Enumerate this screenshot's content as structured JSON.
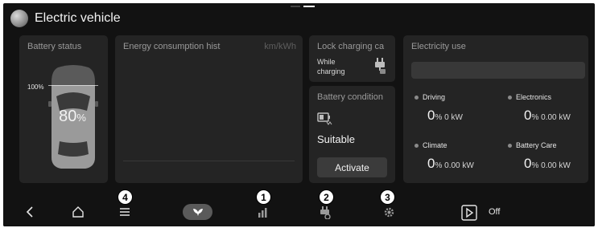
{
  "header": {
    "title": "Electric vehicle"
  },
  "battery": {
    "title": "Battery status",
    "full_label": "100%",
    "level_value": "80",
    "level_unit": "%",
    "level_fraction": 0.8
  },
  "energy": {
    "title": "Energy consumption hist",
    "unit": "km/kWh"
  },
  "lock_charging": {
    "title": "Lock charging ca",
    "state_line1": "While",
    "state_line2": "charging",
    "icon": "plug-lock-icon"
  },
  "battery_condition": {
    "title": "Battery condition",
    "status": "Suitable",
    "button_label": "Activate",
    "icon": "battery-heater-icon"
  },
  "electricity": {
    "title": "Electricity use",
    "items": [
      {
        "label": "Driving",
        "value": "0",
        "unit": "% 0 kW"
      },
      {
        "label": "Electronics",
        "value": "0",
        "unit": "% 0.00 kW"
      },
      {
        "label": "Climate",
        "value": "0",
        "unit": "% 0.00 kW"
      },
      {
        "label": "Battery Care",
        "value": "0",
        "unit": "% 0.00 kW"
      }
    ]
  },
  "nav": {
    "icons": [
      "back-icon",
      "home-icon",
      "menu-icon",
      "leaf-icon",
      "bar-chart-icon",
      "plug-settings-icon",
      "gear-icon",
      "play-icon"
    ],
    "toggle_label": "Off"
  },
  "callouts": [
    "1",
    "2",
    "3",
    "4"
  ],
  "colors": {
    "background": "#121212",
    "panel": "#242424",
    "button": "#3b3b3b",
    "text": "#f2f2f2",
    "muted": "#9a9a9a"
  }
}
